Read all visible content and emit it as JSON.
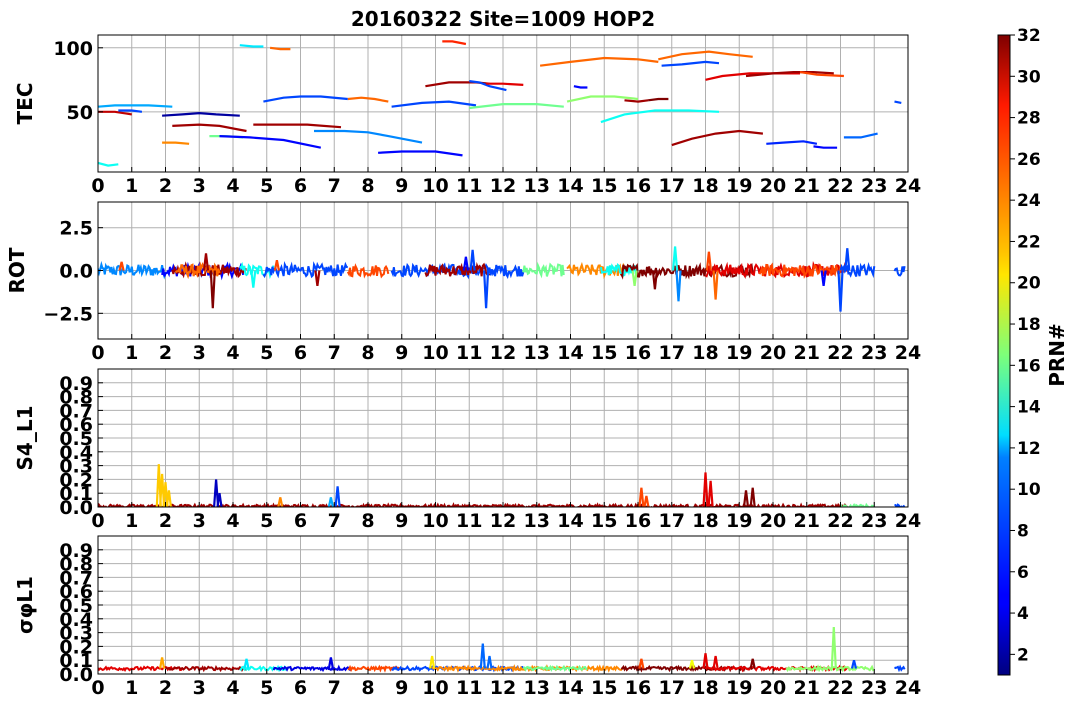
{
  "title": "20160322 Site=1009 HOP2",
  "colorbar": {
    "label": "PRN#",
    "min": 1,
    "max": 32,
    "ticks": [
      2,
      4,
      6,
      8,
      10,
      12,
      14,
      16,
      18,
      20,
      22,
      24,
      26,
      28,
      30,
      32
    ],
    "colormap": "jet"
  },
  "x_ticks": [
    "0",
    "1",
    "2",
    "3",
    "4",
    "5",
    "6",
    "7",
    "8",
    "9",
    "10",
    "11",
    "12",
    "13",
    "14",
    "15",
    "16",
    "17",
    "18",
    "19",
    "20",
    "21",
    "22",
    "23",
    "24"
  ],
  "chart_data": [
    {
      "type": "line",
      "ylabel": "TEC",
      "xlim": [
        0,
        24
      ],
      "ylim": [
        3,
        110
      ],
      "yticks": [
        {
          "v": 50,
          "label": "50"
        },
        {
          "v": 100,
          "label": "100"
        }
      ],
      "grid": true,
      "series": [
        {
          "prn": 30,
          "x": [
            0.0,
            0.5,
            1.0
          ],
          "y": [
            50,
            50,
            48
          ]
        },
        {
          "prn": 10,
          "x": [
            0.0,
            0.5,
            1.0,
            1.5,
            2.2
          ],
          "y": [
            54,
            55,
            55,
            55,
            54
          ]
        },
        {
          "prn": 7,
          "x": [
            0.6,
            1.0,
            1.3
          ],
          "y": [
            51,
            51,
            50
          ]
        },
        {
          "prn": 13,
          "x": [
            0.0,
            0.3,
            0.6
          ],
          "y": [
            10,
            8,
            9
          ]
        },
        {
          "prn": 2,
          "x": [
            1.9,
            2.5,
            3.0,
            3.5,
            4.2
          ],
          "y": [
            47,
            48,
            49,
            48,
            47
          ]
        },
        {
          "prn": 31,
          "x": [
            2.2,
            3.0,
            3.6,
            4.4
          ],
          "y": [
            39,
            40,
            39,
            35
          ]
        },
        {
          "prn": 24,
          "x": [
            1.9,
            2.3,
            2.7
          ],
          "y": [
            26,
            26,
            25
          ]
        },
        {
          "prn": 16,
          "x": [
            3.3,
            3.8,
            4.3
          ],
          "y": [
            31,
            31,
            30
          ]
        },
        {
          "prn": 5,
          "x": [
            3.6,
            4.5,
            5.5,
            6.6
          ],
          "y": [
            31,
            30,
            28,
            22
          ]
        },
        {
          "prn": 12,
          "x": [
            4.2,
            4.6,
            4.9
          ],
          "y": [
            102,
            101,
            101
          ]
        },
        {
          "prn": 25,
          "x": [
            5.1,
            5.4,
            5.7
          ],
          "y": [
            100,
            99,
            99
          ]
        },
        {
          "prn": 31,
          "x": [
            4.6,
            5.5,
            6.2,
            7.2
          ],
          "y": [
            40,
            40,
            40,
            38
          ]
        },
        {
          "prn": 7,
          "x": [
            4.9,
            5.5,
            6.0,
            6.6,
            7.4
          ],
          "y": [
            58,
            61,
            62,
            62,
            60
          ]
        },
        {
          "prn": 9,
          "x": [
            6.4,
            7.3,
            8.0,
            8.6,
            9.6
          ],
          "y": [
            35,
            35,
            34,
            31,
            26
          ]
        },
        {
          "prn": 25,
          "x": [
            7.4,
            7.8,
            8.2,
            8.6
          ],
          "y": [
            60,
            61,
            60,
            58
          ]
        },
        {
          "prn": 7,
          "x": [
            8.7,
            9.6,
            10.4,
            11.2
          ],
          "y": [
            54,
            57,
            58,
            55
          ]
        },
        {
          "prn": 5,
          "x": [
            8.3,
            9.0,
            10.0,
            10.8
          ],
          "y": [
            18,
            19,
            19,
            16
          ]
        },
        {
          "prn": 31,
          "x": [
            9.7,
            10.4,
            11.2,
            11.6
          ],
          "y": [
            70,
            73,
            73,
            72
          ]
        },
        {
          "prn": 27,
          "x": [
            10.2,
            10.5,
            10.9
          ],
          "y": [
            105,
            105,
            103
          ]
        },
        {
          "prn": 7,
          "x": [
            11.0,
            11.3,
            11.6,
            12.1
          ],
          "y": [
            74,
            73,
            70,
            67
          ]
        },
        {
          "prn": 29,
          "x": [
            11.5,
            12.0,
            12.6
          ],
          "y": [
            72,
            72,
            71
          ]
        },
        {
          "prn": 16,
          "x": [
            11.0,
            12.0,
            13.0,
            13.8
          ],
          "y": [
            53,
            56,
            56,
            54
          ]
        },
        {
          "prn": 5,
          "x": [
            14.1,
            14.3,
            14.5
          ],
          "y": [
            70,
            69,
            69
          ]
        },
        {
          "prn": 17,
          "x": [
            13.9,
            14.6,
            15.3,
            16.0
          ],
          "y": [
            58,
            62,
            62,
            60
          ]
        },
        {
          "prn": 13,
          "x": [
            14.9,
            15.6,
            16.5,
            17.5,
            18.4
          ],
          "y": [
            42,
            48,
            51,
            51,
            50
          ]
        },
        {
          "prn": 25,
          "x": [
            13.1,
            14.0,
            15.0,
            16.0,
            16.6
          ],
          "y": [
            86,
            89,
            92,
            91,
            89
          ]
        },
        {
          "prn": 31,
          "x": [
            15.6,
            16.0,
            16.3
          ],
          "y": [
            59,
            58,
            59
          ]
        },
        {
          "prn": 32,
          "x": [
            16.3,
            16.6,
            16.9
          ],
          "y": [
            59,
            60,
            60
          ]
        },
        {
          "prn": 25,
          "x": [
            16.6,
            17.3,
            18.1,
            18.7,
            19.4
          ],
          "y": [
            91,
            95,
            97,
            95,
            93
          ]
        },
        {
          "prn": 7,
          "x": [
            16.7,
            17.3,
            18.0,
            18.4
          ],
          "y": [
            86,
            87,
            89,
            88
          ]
        },
        {
          "prn": 29,
          "x": [
            18.0,
            18.5,
            19.3,
            20.0,
            20.8
          ],
          "y": [
            75,
            78,
            80,
            80,
            80
          ]
        },
        {
          "prn": 31,
          "x": [
            19.2,
            20.0,
            20.6,
            21.2,
            21.8
          ],
          "y": [
            78,
            80,
            81,
            81,
            80
          ]
        },
        {
          "prn": 26,
          "x": [
            20.8,
            21.3,
            22.1
          ],
          "y": [
            81,
            79,
            78
          ]
        },
        {
          "prn": 31,
          "x": [
            17.0,
            17.6,
            18.3,
            19.0,
            19.7
          ],
          "y": [
            24,
            29,
            33,
            35,
            33
          ]
        },
        {
          "prn": 6,
          "x": [
            19.8,
            20.3,
            20.9,
            21.3
          ],
          "y": [
            25,
            26,
            27,
            25
          ]
        },
        {
          "prn": 5,
          "x": [
            21.2,
            21.5,
            21.9
          ],
          "y": [
            23,
            22,
            22
          ]
        },
        {
          "prn": 8,
          "x": [
            22.1,
            22.6,
            23.1
          ],
          "y": [
            30,
            30,
            33
          ]
        },
        {
          "prn": 7,
          "x": [
            23.6,
            23.8
          ],
          "y": [
            58,
            57
          ]
        }
      ]
    },
    {
      "type": "line",
      "ylabel": "ROT",
      "xlim": [
        0,
        24
      ],
      "ylim": [
        -4,
        4
      ],
      "yticks": [
        {
          "v": 2.5,
          "label": "2.5"
        },
        {
          "v": 0,
          "label": "0.0"
        },
        {
          "v": -2.5,
          "label": "−2.5"
        }
      ],
      "grid": true,
      "spikes": [
        {
          "prn": 26,
          "x": 0.7,
          "y": 0.5
        },
        {
          "prn": 32,
          "x": 3.4,
          "y": -2.2
        },
        {
          "prn": 31,
          "x": 3.2,
          "y": 1.0
        },
        {
          "prn": 13,
          "x": 4.6,
          "y": -1.0
        },
        {
          "prn": 26,
          "x": 5.3,
          "y": 0.6
        },
        {
          "prn": 31,
          "x": 6.5,
          "y": -0.9
        },
        {
          "prn": 7,
          "x": 11.1,
          "y": 1.2
        },
        {
          "prn": 7,
          "x": 11.5,
          "y": -2.2
        },
        {
          "prn": 5,
          "x": 10.9,
          "y": 0.8
        },
        {
          "prn": 17,
          "x": 15.9,
          "y": -0.9
        },
        {
          "prn": 32,
          "x": 16.5,
          "y": -1.1
        },
        {
          "prn": 13,
          "x": 17.1,
          "y": 1.4
        },
        {
          "prn": 9,
          "x": 17.2,
          "y": -1.8
        },
        {
          "prn": 25,
          "x": 18.3,
          "y": -1.7
        },
        {
          "prn": 26,
          "x": 18.1,
          "y": 1.1
        },
        {
          "prn": 7,
          "x": 22.2,
          "y": 1.3
        },
        {
          "prn": 7,
          "x": 22.0,
          "y": -2.4
        },
        {
          "prn": 5,
          "x": 21.5,
          "y": -0.9
        }
      ],
      "segments": [
        {
          "prn": 9,
          "x0": 0.0,
          "x1": 2.0
        },
        {
          "prn": 5,
          "x0": 1.9,
          "x1": 4.3
        },
        {
          "prn": 31,
          "x0": 2.2,
          "x1": 4.4
        },
        {
          "prn": 25,
          "x0": 2.3,
          "x1": 3.6
        },
        {
          "prn": 13,
          "x0": 4.2,
          "x1": 5.2
        },
        {
          "prn": 7,
          "x0": 4.9,
          "x1": 7.4
        },
        {
          "prn": 26,
          "x0": 7.4,
          "x1": 8.6
        },
        {
          "prn": 7,
          "x0": 8.7,
          "x1": 12.6
        },
        {
          "prn": 31,
          "x0": 9.7,
          "x1": 11.6
        },
        {
          "prn": 16,
          "x0": 12.6,
          "x1": 13.8
        },
        {
          "prn": 24,
          "x0": 13.9,
          "x1": 15.6
        },
        {
          "prn": 13,
          "x0": 14.9,
          "x1": 16.0
        },
        {
          "prn": 32,
          "x0": 15.5,
          "x1": 19.4
        },
        {
          "prn": 29,
          "x0": 18.0,
          "x1": 22.2
        },
        {
          "prn": 26,
          "x0": 19.6,
          "x1": 22.1
        },
        {
          "prn": 7,
          "x0": 22.0,
          "x1": 23.0
        },
        {
          "prn": 7,
          "x0": 23.6,
          "x1": 23.9
        }
      ]
    },
    {
      "type": "line",
      "ylabel": "S4_L1",
      "xlim": [
        0,
        24
      ],
      "ylim": [
        0,
        1.0
      ],
      "yticks": [
        {
          "v": 0,
          "label": "0.0"
        },
        {
          "v": 0.1,
          "label": "0.1"
        },
        {
          "v": 0.2,
          "label": "0.2"
        },
        {
          "v": 0.3,
          "label": "0.3"
        },
        {
          "v": 0.4,
          "label": "0.4"
        },
        {
          "v": 0.5,
          "label": "0.5"
        },
        {
          "v": 0.6,
          "label": "0.6"
        },
        {
          "v": 0.7,
          "label": "0.7"
        },
        {
          "v": 0.8,
          "label": "0.8"
        },
        {
          "v": 0.9,
          "label": "0.9"
        }
      ],
      "grid": true,
      "spikes": [
        {
          "prn": 22,
          "x": 1.8,
          "y": 0.31
        },
        {
          "prn": 22,
          "x": 1.9,
          "y": 0.24
        },
        {
          "prn": 22,
          "x": 2.0,
          "y": 0.18
        },
        {
          "prn": 22,
          "x": 2.1,
          "y": 0.12
        },
        {
          "prn": 3,
          "x": 3.5,
          "y": 0.2
        },
        {
          "prn": 3,
          "x": 3.6,
          "y": 0.1
        },
        {
          "prn": 24,
          "x": 5.4,
          "y": 0.07
        },
        {
          "prn": 10,
          "x": 6.9,
          "y": 0.07
        },
        {
          "prn": 7,
          "x": 7.1,
          "y": 0.15
        },
        {
          "prn": 26,
          "x": 16.1,
          "y": 0.14
        },
        {
          "prn": 26,
          "x": 16.25,
          "y": 0.08
        },
        {
          "prn": 29,
          "x": 18.0,
          "y": 0.25
        },
        {
          "prn": 29,
          "x": 18.15,
          "y": 0.19
        },
        {
          "prn": 32,
          "x": 19.2,
          "y": 0.12
        },
        {
          "prn": 32,
          "x": 19.4,
          "y": 0.14
        }
      ],
      "segments": [
        {
          "prn": 31,
          "x0": 0.0,
          "x1": 22.2
        },
        {
          "prn": 16,
          "x0": 22.0,
          "x1": 23.0
        },
        {
          "prn": 7,
          "x0": 23.6,
          "x1": 23.9
        }
      ]
    },
    {
      "type": "line",
      "ylabel": "σφL1",
      "xlim": [
        0,
        24
      ],
      "ylim": [
        0,
        1.0
      ],
      "yticks": [
        {
          "v": 0,
          "label": "0.0"
        },
        {
          "v": 0.1,
          "label": "0.1"
        },
        {
          "v": 0.2,
          "label": "0.2"
        },
        {
          "v": 0.3,
          "label": "0.3"
        },
        {
          "v": 0.4,
          "label": "0.4"
        },
        {
          "v": 0.5,
          "label": "0.5"
        },
        {
          "v": 0.6,
          "label": "0.6"
        },
        {
          "v": 0.7,
          "label": "0.7"
        },
        {
          "v": 0.8,
          "label": "0.8"
        },
        {
          "v": 0.9,
          "label": "0.9"
        }
      ],
      "grid": true,
      "spikes": [
        {
          "prn": 23,
          "x": 1.9,
          "y": 0.12
        },
        {
          "prn": 12,
          "x": 4.4,
          "y": 0.11
        },
        {
          "prn": 4,
          "x": 6.9,
          "y": 0.12
        },
        {
          "prn": 21,
          "x": 9.9,
          "y": 0.13
        },
        {
          "prn": 8,
          "x": 11.4,
          "y": 0.22
        },
        {
          "prn": 8,
          "x": 11.6,
          "y": 0.13
        },
        {
          "prn": 26,
          "x": 16.1,
          "y": 0.11
        },
        {
          "prn": 20,
          "x": 17.6,
          "y": 0.1
        },
        {
          "prn": 29,
          "x": 18.0,
          "y": 0.15
        },
        {
          "prn": 29,
          "x": 18.3,
          "y": 0.13
        },
        {
          "prn": 32,
          "x": 19.4,
          "y": 0.11
        },
        {
          "prn": 17,
          "x": 21.8,
          "y": 0.34
        },
        {
          "prn": 7,
          "x": 22.4,
          "y": 0.1
        }
      ],
      "segments": [
        {
          "prn": 29,
          "x0": 0.0,
          "x1": 2.5
        },
        {
          "prn": 31,
          "x0": 2.0,
          "x1": 4.4
        },
        {
          "prn": 13,
          "x0": 4.2,
          "x1": 5.6
        },
        {
          "prn": 4,
          "x0": 5.2,
          "x1": 7.5
        },
        {
          "prn": 26,
          "x0": 7.4,
          "x1": 9.0
        },
        {
          "prn": 7,
          "x0": 8.7,
          "x1": 12.6
        },
        {
          "prn": 24,
          "x0": 9.9,
          "x1": 15.6
        },
        {
          "prn": 16,
          "x0": 12.6,
          "x1": 14.5
        },
        {
          "prn": 32,
          "x0": 15.5,
          "x1": 19.4
        },
        {
          "prn": 29,
          "x0": 18.0,
          "x1": 22.2
        },
        {
          "prn": 17,
          "x0": 20.4,
          "x1": 23.0
        },
        {
          "prn": 7,
          "x0": 23.6,
          "x1": 23.9
        }
      ]
    }
  ]
}
